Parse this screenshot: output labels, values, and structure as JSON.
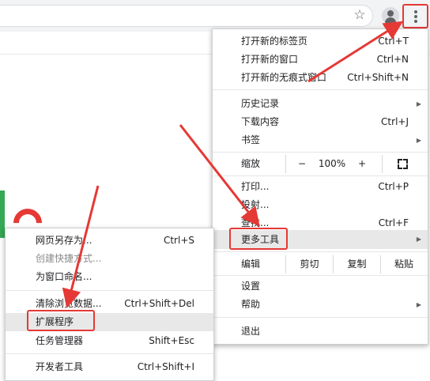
{
  "colors": {
    "highlight": "#e53935",
    "menu_hover": "#e8e8e8"
  },
  "toolbar": {
    "star_icon": "☆"
  },
  "main_menu": {
    "new_tab": "打开新的标签页",
    "new_tab_sc": "Ctrl+T",
    "new_window": "打开新的窗口",
    "new_window_sc": "Ctrl+N",
    "incognito": "打开新的无痕式窗口",
    "incognito_sc": "Ctrl+Shift+N",
    "history": "历史记录",
    "downloads": "下载内容",
    "downloads_sc": "Ctrl+J",
    "bookmarks": "书签",
    "zoom": "缩放",
    "zoom_minus": "−",
    "zoom_value": "100%",
    "zoom_plus": "+",
    "print": "打印...",
    "print_sc": "Ctrl+P",
    "cast": "投射...",
    "find": "查找...",
    "find_sc": "Ctrl+F",
    "more_tools": "更多工具",
    "edit": "编辑",
    "cut": "剪切",
    "copy": "复制",
    "paste": "粘贴",
    "settings": "设置",
    "help": "帮助",
    "exit": "退出"
  },
  "sub_menu": {
    "save_as": "网页另存为...",
    "save_as_sc": "Ctrl+S",
    "create_shortcut": "创建快捷方式...",
    "name_window": "为窗口命名...",
    "clear_data": "清除浏览数据...",
    "clear_data_sc": "Ctrl+Shift+Del",
    "extensions": "扩展程序",
    "task_manager": "任务管理器",
    "task_manager_sc": "Shift+Esc",
    "dev_tools": "开发者工具",
    "dev_tools_sc": "Ctrl+Shift+I"
  }
}
